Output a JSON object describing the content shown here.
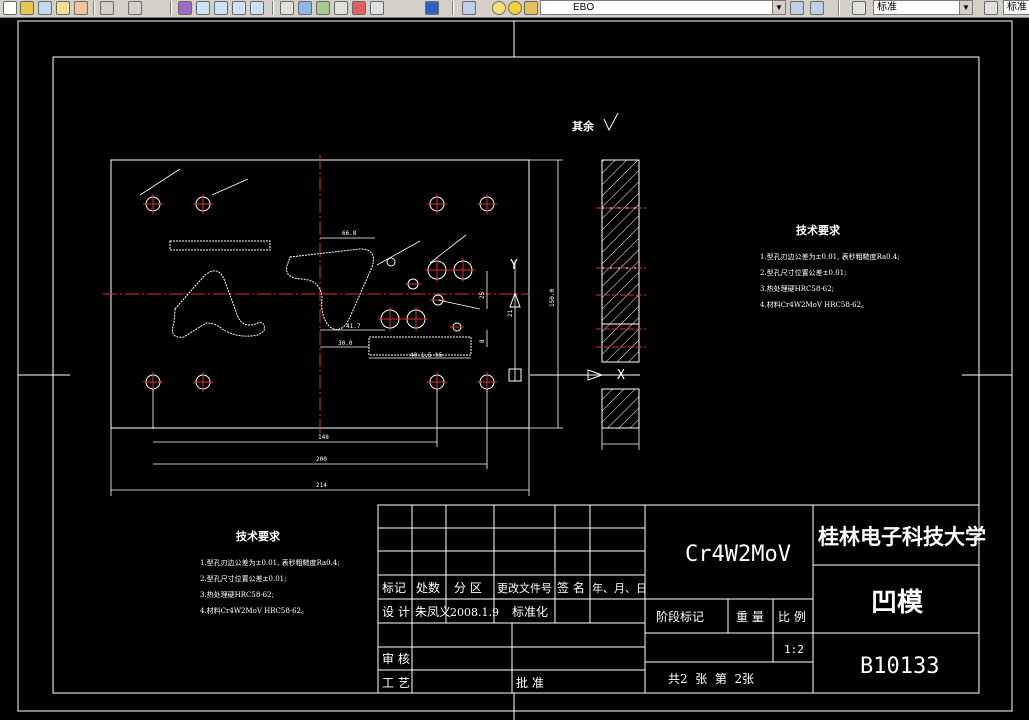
{
  "toolbar": {
    "layer_combo": "EBO",
    "text_style_combo": "标准",
    "dim_style_combo": "标准"
  },
  "drawing": {
    "roughness_label": "其余",
    "tech_req_title": "技术要求",
    "tech_req_items": [
      "1.型孔刃边公差为±0.01, 表秒粗糙度Ra0.4;",
      "2.型孔尺寸位置公差±0.01;",
      "3.热处理硬HRC58-62;",
      "4.材料Cr4W2MoV HRC58-62。"
    ],
    "tech_req2_title": "技术要求",
    "tech_req2_items": [
      "1.型孔刃边公差为±0.01, 表秒粗糙度Ra0.4;",
      "2.型孔尺寸位置公差±0.01;",
      "3.热处理硬HRC58-62;",
      "4.材料Cr4W2MoV HRC58-62。"
    ],
    "dims": {
      "d_148": "148",
      "d_200": "200",
      "d_214": "214",
      "d_150": "150.0",
      "d_66": "66.8",
      "d_41": "41.7",
      "d_30": "30.0",
      "d_40": "40.1.5 h5",
      "d_25": "25",
      "d_8": "8",
      "d_21": "21"
    }
  },
  "title_block": {
    "material": "Cr4W2MoV",
    "university": "桂林电子科技大学",
    "part_name": "凹模",
    "drawing_no": "B10133",
    "headers": [
      "标记",
      "处数",
      "分 区",
      "更改文件号",
      "签 名",
      "年、月、日"
    ],
    "design_label": "设 计",
    "designer": "朱凤义",
    "design_date": "2008.1.9",
    "standard_label": "标准化",
    "stage_label": "阶段标记",
    "weight_label": "重 量",
    "scale_label": "比 例",
    "scale_value": "1:2",
    "review_label": "审 核",
    "process_label": "工 艺",
    "approve_label": "批 准",
    "sheets": "共2  张  第  2张"
  }
}
